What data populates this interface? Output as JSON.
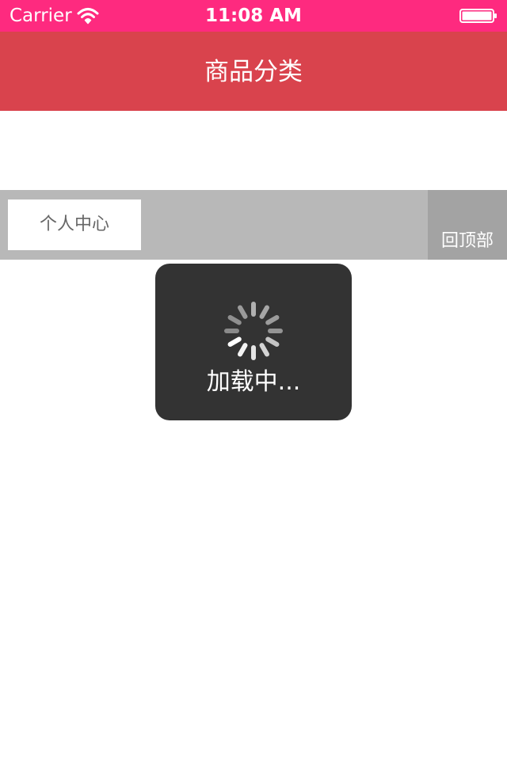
{
  "status_bar": {
    "carrier": "Carrier",
    "time": "11:08 AM",
    "background": "#fe2a7f",
    "wifi_icon": "wifi-icon",
    "battery_icon": "battery-icon"
  },
  "nav_bar": {
    "title": "商品分类",
    "background": "#d9434d"
  },
  "tab_strip": {
    "profile_label": "个人中心",
    "back_to_top_label": "回顶部"
  },
  "loading": {
    "label": "加载中...",
    "spinner_icon": "spinner-icon"
  }
}
